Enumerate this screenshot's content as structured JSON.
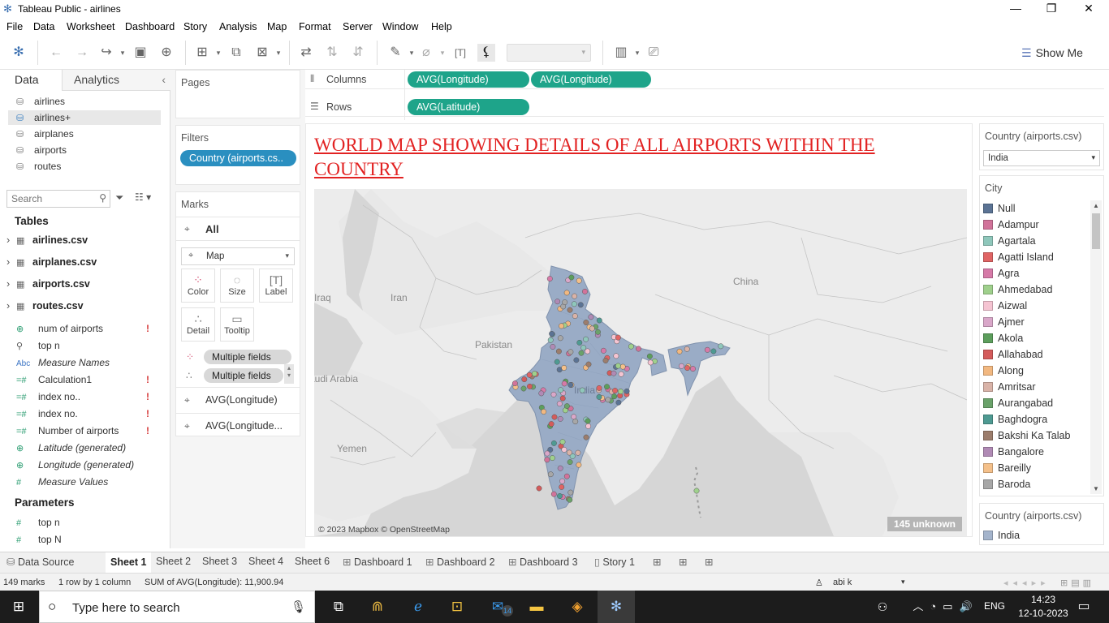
{
  "window": {
    "title": "Tableau Public - airlines",
    "min": "—",
    "max": "❐",
    "close": "✕"
  },
  "menu": [
    "File",
    "Data",
    "Worksheet",
    "Dashboard",
    "Story",
    "Analysis",
    "Map",
    "Format",
    "Server",
    "Window",
    "Help"
  ],
  "toolbar": {
    "show_me": "Show Me"
  },
  "left_panel": {
    "tab_data": "Data",
    "tab_analytics": "Analytics",
    "data_sources": [
      "airlines",
      "airlines+",
      "airplanes",
      "airports",
      "routes"
    ],
    "search_placeholder": "Search",
    "tables_header": "Tables",
    "tables": [
      "airlines.csv",
      "airplanes.csv",
      "airports.csv",
      "routes.csv"
    ],
    "fields": [
      {
        "icon": "globe-icon",
        "glyph": "⊕",
        "name": "num of airports",
        "italic": false,
        "warn": true
      },
      {
        "icon": "set-icon",
        "glyph": "⚲",
        "name": "top n",
        "italic": false,
        "warn": false
      },
      {
        "icon": "abc-icon",
        "glyph": "Abc",
        "name": "Measure Names",
        "italic": true,
        "warn": false
      },
      {
        "icon": "calc-icon",
        "glyph": "=#",
        "name": "Calculation1",
        "italic": false,
        "warn": true
      },
      {
        "icon": "calc-icon",
        "glyph": "=#",
        "name": "index no..",
        "italic": false,
        "warn": true
      },
      {
        "icon": "calc-icon",
        "glyph": "=#",
        "name": "index no.",
        "italic": false,
        "warn": true
      },
      {
        "icon": "calc-icon",
        "glyph": "=#",
        "name": "Number of airports",
        "italic": false,
        "warn": true
      },
      {
        "icon": "globe-icon",
        "glyph": "⊕",
        "name": "Latitude (generated)",
        "italic": true,
        "warn": false
      },
      {
        "icon": "globe-icon",
        "glyph": "⊕",
        "name": "Longitude (generated)",
        "italic": true,
        "warn": false
      },
      {
        "icon": "hash-icon",
        "glyph": "#",
        "name": "Measure Values",
        "italic": true,
        "warn": false
      }
    ],
    "parameters_header": "Parameters",
    "parameters": [
      "top n",
      "top N"
    ]
  },
  "shelves": {
    "pages": "Pages",
    "filters": "Filters",
    "filter_pill": "Country (airports.cs..",
    "columns_label": "Columns",
    "columns_pills": [
      "AVG(Longitude)",
      "AVG(Longitude)"
    ],
    "rows_label": "Rows",
    "rows_pills": [
      "AVG(Latitude)"
    ]
  },
  "marks": {
    "header": "Marks",
    "all": "All",
    "mark_type": "Map",
    "buttons": [
      "Color",
      "Size",
      "Label",
      "Detail",
      "Tooltip"
    ],
    "multiple_fields_1": "Multiple fields",
    "multiple_fields_2": "Multiple fields",
    "layer_1": "AVG(Longitude)",
    "layer_2": "AVG(Longitude..."
  },
  "view": {
    "title": "WORLD MAP SHOWING DETAILS OF ALL AIRPORTS WITHIN THE COUNTRY",
    "labels": [
      "Iraq",
      "Iran",
      "China",
      "Pakistan",
      "Saudi Arabia",
      "India",
      "Yemen"
    ],
    "attribution": "© 2023 Mapbox © OpenStreetMap",
    "unknown_badge": "145 unknown"
  },
  "legend_filter": {
    "title": "Country (airports.csv)",
    "value": "India"
  },
  "legend_city": {
    "title": "City",
    "items": [
      {
        "name": "Null",
        "color": "#5b7394"
      },
      {
        "name": "Adampur",
        "color": "#d1739a"
      },
      {
        "name": "Agartala",
        "color": "#8fc7bb"
      },
      {
        "name": "Agatti Island",
        "color": "#e06464"
      },
      {
        "name": "Agra",
        "color": "#d67aa8"
      },
      {
        "name": "Ahmedabad",
        "color": "#9fd08c"
      },
      {
        "name": "Aizwal",
        "color": "#f5c4d2"
      },
      {
        "name": "Ajmer",
        "color": "#d9a7c9"
      },
      {
        "name": "Akola",
        "color": "#5c9e5c"
      },
      {
        "name": "Allahabad",
        "color": "#d45b5b"
      },
      {
        "name": "Along",
        "color": "#f2b880"
      },
      {
        "name": "Amritsar",
        "color": "#d9b3a8"
      },
      {
        "name": "Aurangabad",
        "color": "#6aa26a"
      },
      {
        "name": "Baghdogra",
        "color": "#4e9a92"
      },
      {
        "name": "Bakshi Ka Talab",
        "color": "#9c7d6c"
      },
      {
        "name": "Bangalore",
        "color": "#b08ab5"
      },
      {
        "name": "Bareilly",
        "color": "#f4c08a"
      },
      {
        "name": "Baroda",
        "color": "#a7a7a7"
      }
    ]
  },
  "legend_country": {
    "title": "Country (airports.csv)",
    "items": [
      {
        "name": "India",
        "color": "#a4b4cc"
      }
    ]
  },
  "sheet_tabs": [
    "Data Source",
    "Sheet 1",
    "Sheet 2",
    "Sheet 3",
    "Sheet 4",
    "Sheet 6",
    "Dashboard 1",
    "Dashboard 2",
    "Dashboard 3",
    "Story 1"
  ],
  "status": {
    "marks": "149 marks",
    "rows": "1 row by 1 column",
    "sum": "SUM of AVG(Longitude): 11,900.94",
    "user": "abi k"
  },
  "taskbar": {
    "search_placeholder": "Type here to search",
    "mail_badge": "14",
    "lang": "ENG",
    "time": "14:23",
    "date": "12-10-2023"
  }
}
